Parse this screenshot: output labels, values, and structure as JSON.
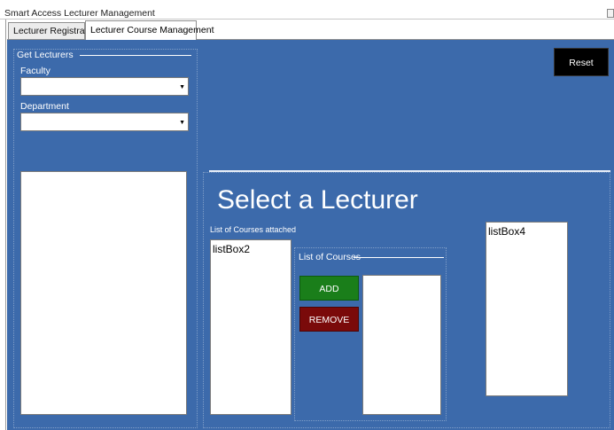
{
  "window": {
    "title": "Smart Access Lecturer Management"
  },
  "tabs": [
    {
      "label": "Lecturer Registration",
      "active": false
    },
    {
      "label": "Lecturer Course Management",
      "active": true
    }
  ],
  "get_lecturers": {
    "legend": "Get Lecturers",
    "faculty_label": "Faculty",
    "faculty_value": "",
    "department_label": "Department",
    "department_value": ""
  },
  "reset_label": "Reset",
  "main": {
    "heading": "Select a Lecturer",
    "attached_label": "List of Courses attached",
    "attached_listbox": "listBox2",
    "list_of_courses_legend": "List of Courses",
    "add_label": "ADD",
    "remove_label": "REMOVE",
    "listbox4": "listBox4"
  },
  "colors": {
    "panel_background": "#3c6aab",
    "add_button": "#1a7e1a",
    "remove_button": "#7a0a0a",
    "reset_button": "#000000"
  },
  "icons": {
    "combo_arrow": "chevron-down-icon"
  }
}
